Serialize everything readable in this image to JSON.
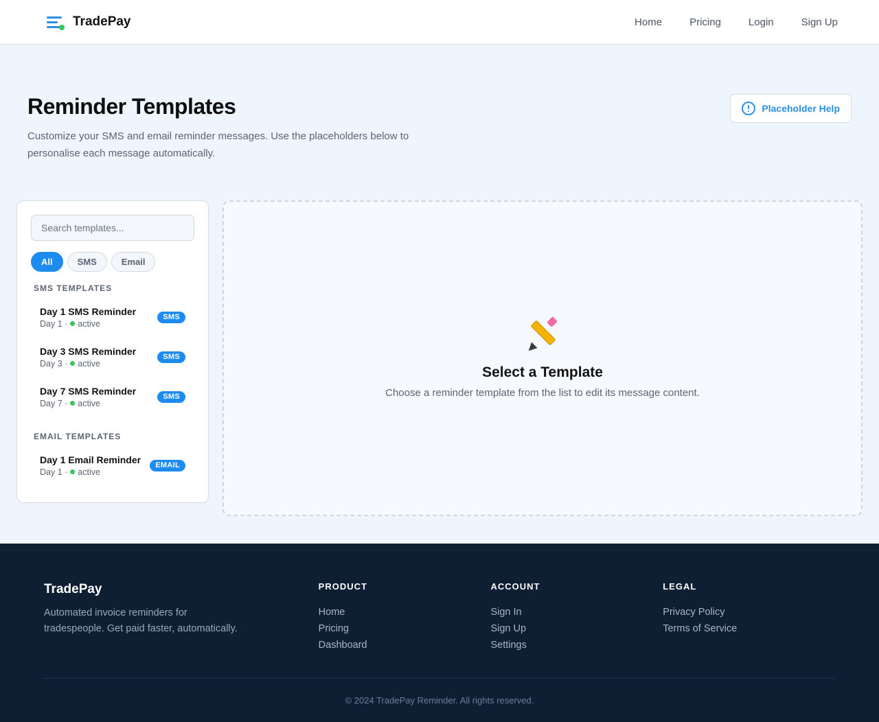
{
  "header": {
    "brand": "TradePay",
    "nav": [
      "Home",
      "Pricing",
      "Login",
      "Sign Up"
    ]
  },
  "page": {
    "title": "Reminder Templates",
    "subtitle": "Customize your SMS and email reminder messages. Use the placeholders below to personalise each message automatically.",
    "help_button": "Placeholder Help"
  },
  "sidebar": {
    "search_placeholder": "Search templates...",
    "filters": [
      {
        "label": "All",
        "active": true
      },
      {
        "label": "SMS",
        "active": false
      },
      {
        "label": "Email",
        "active": false
      }
    ],
    "sms_section": "SMS Templates",
    "sms_templates": [
      {
        "name": "Day 1 SMS Reminder",
        "day": "Day 1 ·",
        "status": "active",
        "badge": "SMS"
      },
      {
        "name": "Day 3 SMS Reminder",
        "day": "Day 3 ·",
        "status": "active",
        "badge": "SMS"
      },
      {
        "name": "Day 7 SMS Reminder",
        "day": "Day 7 ·",
        "status": "active",
        "badge": "SMS"
      }
    ],
    "email_section": "Email Templates",
    "email_templates": [
      {
        "name": "Day 1 Email Reminder",
        "day": "Day 1 ·",
        "status": "active",
        "badge": "EMAIL"
      }
    ]
  },
  "editor": {
    "icon": "pencil-icon",
    "title": "Select a Template",
    "subtitle": "Choose a reminder template from the list to edit its message content."
  },
  "footer": {
    "brand": "TradePay",
    "description": "Automated invoice reminders for tradespeople. Get paid faster, automatically.",
    "columns": [
      {
        "title": "PRODUCT",
        "links": [
          "Home",
          "Pricing",
          "Dashboard"
        ]
      },
      {
        "title": "ACCOUNT",
        "links": [
          "Sign In",
          "Sign Up",
          "Settings"
        ]
      },
      {
        "title": "LEGAL",
        "links": [
          "Privacy Policy",
          "Terms of Service"
        ]
      }
    ],
    "copyright": "© 2024 TradePay Reminder. All rights reserved."
  },
  "colors": {
    "accent": "#1e8bf0",
    "active_status": "#34c759",
    "footer_bg": "#0f1f33"
  }
}
